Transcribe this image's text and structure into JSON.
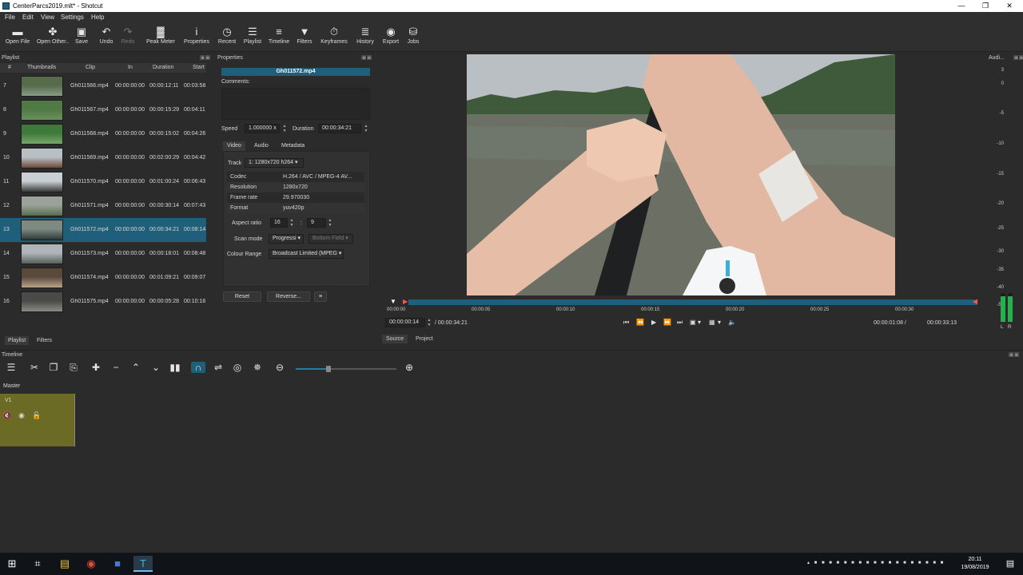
{
  "window": {
    "title": "CenterParcs2019.mlt* - Shotcut",
    "minimize": "—",
    "maximize": "❐",
    "close": "✕"
  },
  "menu": [
    "File",
    "Edit",
    "View",
    "Settings",
    "Help"
  ],
  "toolbar": [
    {
      "label": "Open File",
      "icon": "folder-icon",
      "glyph": "▬"
    },
    {
      "label": "Open Other..",
      "icon": "open-other-icon",
      "glyph": "✤"
    },
    {
      "label": "Save",
      "icon": "save-icon",
      "glyph": "▣"
    },
    {
      "label": "Undo",
      "icon": "undo-icon",
      "glyph": "↶"
    },
    {
      "label": "Redo",
      "icon": "redo-icon",
      "glyph": "↷"
    },
    {
      "label": "Peak Meter",
      "icon": "peak-meter-icon",
      "glyph": "▓"
    },
    {
      "label": "Properties",
      "icon": "info-icon",
      "glyph": "i"
    },
    {
      "label": "Recent",
      "icon": "clock-icon",
      "glyph": "◷"
    },
    {
      "label": "Playlist",
      "icon": "list-icon",
      "glyph": "☰"
    },
    {
      "label": "Timeline",
      "icon": "timeline-icon",
      "glyph": "≡"
    },
    {
      "label": "Filters",
      "icon": "filter-icon",
      "glyph": "▼"
    },
    {
      "label": "Keyframes",
      "icon": "stopwatch-icon",
      "glyph": "⏱"
    },
    {
      "label": "History",
      "icon": "history-icon",
      "glyph": "≣"
    },
    {
      "label": "Export",
      "icon": "export-icon",
      "glyph": "◉"
    },
    {
      "label": "Jobs",
      "icon": "jobs-icon",
      "glyph": "⛁"
    }
  ],
  "playlist": {
    "title": "Playlist",
    "float": "▣▣",
    "columns": [
      "#",
      "Thumbnails",
      "Clip",
      "In",
      "Duration",
      "Start"
    ],
    "rows": [
      {
        "num": "7",
        "clip": "Gh011566.mp4",
        "in": "00:00:00:00",
        "duration": "00:00:12:11",
        "start": "00:03:58",
        "c1": "#556b4a",
        "c2": "#8a9a86"
      },
      {
        "num": "8",
        "clip": "Gh011567.mp4",
        "in": "00:00:00:00",
        "duration": "00:00:15:29",
        "start": "00:04:11",
        "c1": "#4f7a44",
        "c2": "#6b8f5e"
      },
      {
        "num": "9",
        "clip": "Gh011568.mp4",
        "in": "00:00:00:00",
        "duration": "00:00:15:02",
        "start": "00:04:26",
        "c1": "#3e7a3a",
        "c2": "#78a56c"
      },
      {
        "num": "10",
        "clip": "Gh011569.mp4",
        "in": "00:00:00:00",
        "duration": "00:02:00:29",
        "start": "00:04:42",
        "c1": "#b9c0c4",
        "c2": "#6d4a3a"
      },
      {
        "num": "11",
        "clip": "Gh011570.mp4",
        "in": "00:00:00:00",
        "duration": "00:01:00:24",
        "start": "00:06:43",
        "c1": "#c9cfd2",
        "c2": "#3a3a3a"
      },
      {
        "num": "12",
        "clip": "Gh011571.mp4",
        "in": "00:00:00:00",
        "duration": "00:00:30:14",
        "start": "00:07:43",
        "c1": "#9aa29a",
        "c2": "#5a6d4e"
      },
      {
        "num": "13",
        "clip": "Gh011572.mp4",
        "in": "00:00:00:00",
        "duration": "00:00:34:21",
        "start": "00:08:14",
        "c1": "#7d8a84",
        "c2": "#2c3a36"
      },
      {
        "num": "14",
        "clip": "Gh011573.mp4",
        "in": "00:00:00:00",
        "duration": "00:00:18:01",
        "start": "00:08:48",
        "c1": "#aeb4b8",
        "c2": "#57605a"
      },
      {
        "num": "15",
        "clip": "Gh011574.mp4",
        "in": "00:00:00:00",
        "duration": "00:01:09:21",
        "start": "00:09:07",
        "c1": "#5a4a3c",
        "c2": "#b8a48a"
      },
      {
        "num": "16",
        "clip": "Gh011575.mp4",
        "in": "00:00:00:00",
        "duration": "00:00:05:28",
        "start": "00:10:16",
        "c1": "#4a4a48",
        "c2": "#8a8a86"
      }
    ],
    "selected_index": 6,
    "buttons": [
      "+",
      "−",
      "✔",
      "≡",
      "▦",
      "▤",
      "☰"
    ],
    "tabs": [
      "Playlist",
      "Filters"
    ]
  },
  "properties": {
    "title": "Properties",
    "float": "▣▣",
    "clip_name": "Gh011572.mp4",
    "comments_label": "Comments:",
    "speed_label": "Speed",
    "speed_value": "1.000000 x",
    "duration_label": "Duration",
    "duration_value": "00:00:34:21",
    "tabs": [
      "Video",
      "Audio",
      "Metadata"
    ],
    "track_label": "Track",
    "track_value": "1: 1280x720 h264",
    "info": [
      {
        "k": "Codec",
        "v": "H.264 / AVC / MPEG-4 AV..."
      },
      {
        "k": "Resolution",
        "v": "1280x720"
      },
      {
        "k": "Frame rate",
        "v": "29.970030"
      },
      {
        "k": "Format",
        "v": "yuv420p"
      }
    ],
    "aspect_label": "Aspect ratio",
    "aspect_w": "16",
    "aspect_sep": ":",
    "aspect_h": "9",
    "scan_label": "Scan mode",
    "scan_value": "Progressi",
    "field_value": "Bottom Field",
    "colour_label": "Colour Range",
    "colour_value": "Broadcast Limited (MPEG",
    "reset": "Reset",
    "reverse": "Reverse...",
    "menu": "≡"
  },
  "player": {
    "ticks": [
      "00:00:00",
      "00:00:05",
      "00:00:10",
      "00:00:15",
      "00:00:20",
      "00:00:25",
      "00:00:30"
    ],
    "position": "00:00:00:14",
    "total": "/ 00:00:34:21",
    "in_point": "00:00:01:08 /",
    "out_point": "00:00:33:13",
    "tabs": [
      "Source",
      "Project"
    ],
    "transport": [
      "⏮",
      "⏪",
      "▶",
      "⏩",
      "⏭",
      "▣",
      "▾",
      "▦",
      "▾",
      "🔈"
    ]
  },
  "audio": {
    "title": "Audi...",
    "float": "▣▣",
    "scale": [
      "3",
      "0",
      "-5",
      "-10",
      "-15",
      "-20",
      "-25",
      "-30",
      "-35",
      "-40",
      "-50"
    ],
    "channels": [
      "L",
      "R"
    ],
    "level_fraction": 0.12
  },
  "timeline": {
    "title": "Timeline",
    "float": "▣▣",
    "tools": [
      "☰",
      "✂",
      "❐",
      "⎘",
      "✚",
      "−",
      "⌃",
      "⌄",
      "▮▮",
      "∩",
      "⇌",
      "◎",
      "✵",
      "⊖",
      "⊕"
    ],
    "master": "Master",
    "track": "V1",
    "track_icons": [
      "🔇",
      "◉",
      "🔓"
    ]
  },
  "taskbar": {
    "apps": [
      "⊞",
      "⌗",
      "▤",
      "◉",
      "■",
      "T"
    ],
    "time": "20:11",
    "date": "19/08/2019",
    "tray": "▴ ■ ■ ■ ■ ■ ■ ■ ■ ■ ■ ■ ■ ■ ■ ■ ■ ■ ■",
    "notifications": "▤"
  }
}
